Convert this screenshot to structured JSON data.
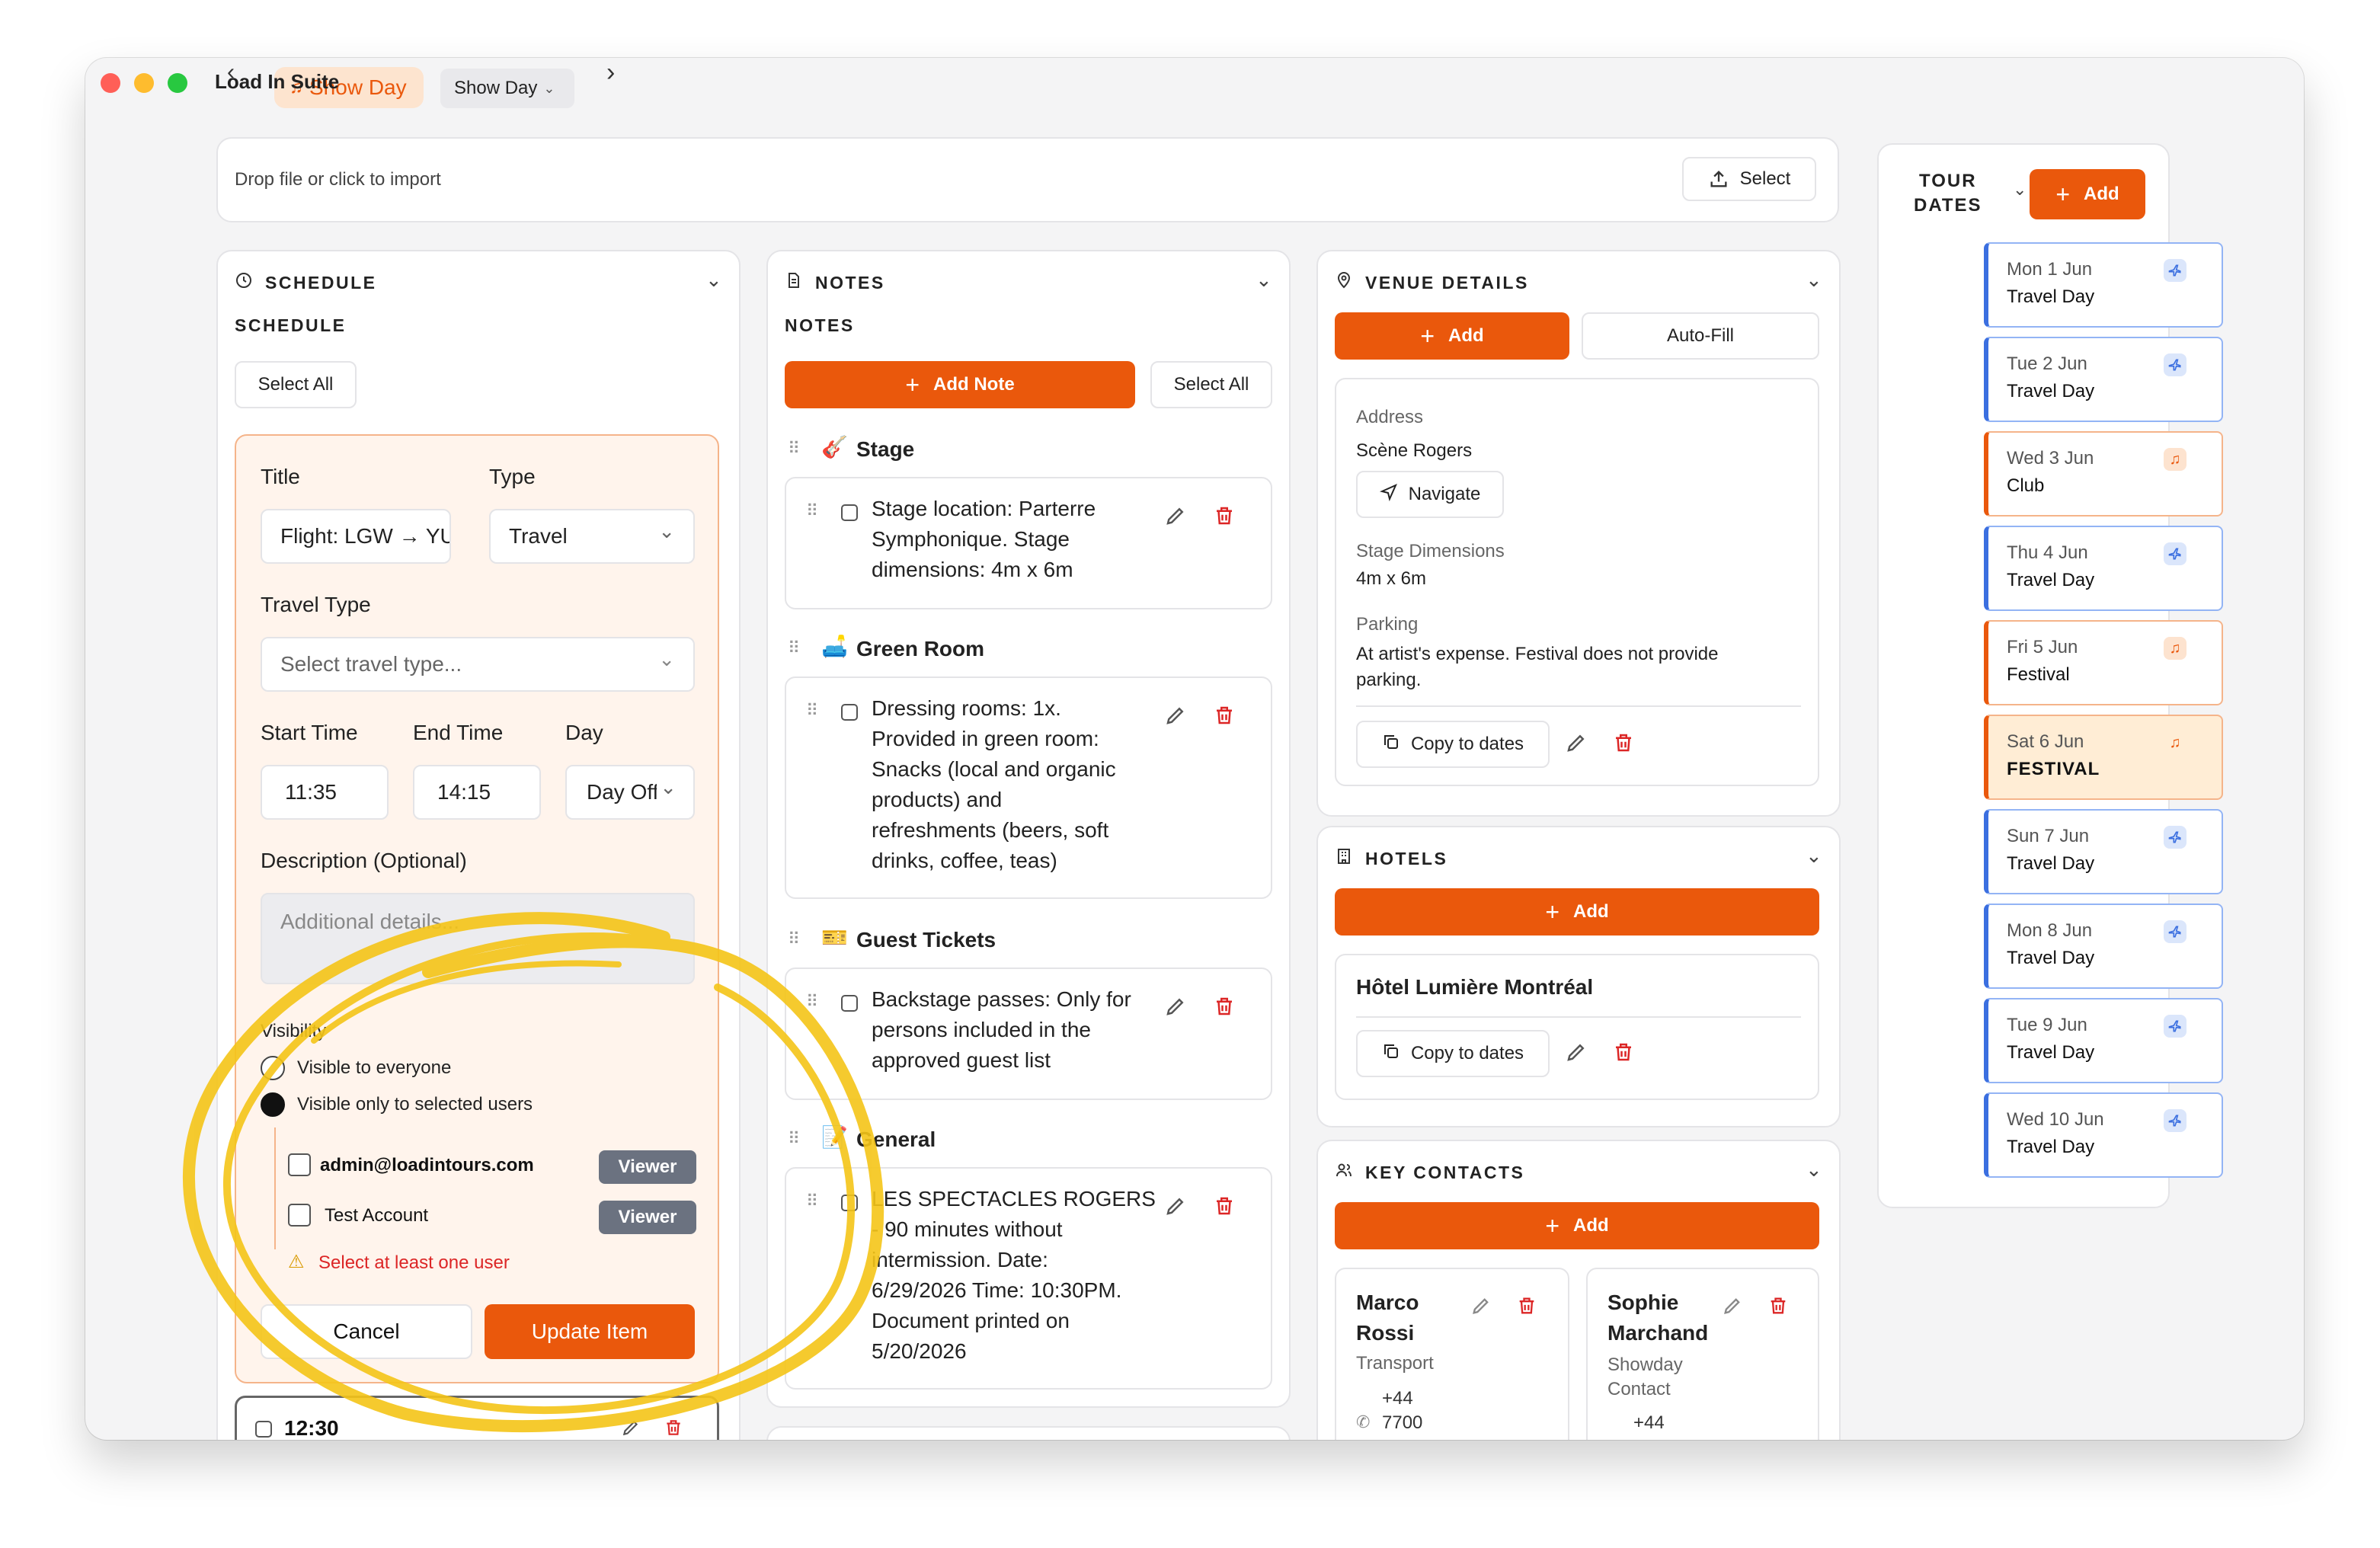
{
  "titlebar": {
    "app_title": "Load In Suite",
    "day_badge": "Show Day",
    "day_select": "Show Day"
  },
  "import_bar": {
    "placeholder": "Drop file or click to import",
    "select_label": "Select"
  },
  "schedule": {
    "header": "SCHEDULE",
    "subheader": "SCHEDULE",
    "select_all": "Select All",
    "form": {
      "title_label": "Title",
      "title_value": "Flight: LGW → YUL",
      "type_label": "Type",
      "type_value": "Travel",
      "travel_type_label": "Travel Type",
      "travel_type_placeholder": "Select travel type...",
      "start_label": "Start Time",
      "start_value": "11:35",
      "end_label": "End Time",
      "end_value": "14:15",
      "day_label": "Day",
      "day_value": "Day Off",
      "desc_label": "Description (Optional)",
      "desc_placeholder": "Additional details...",
      "visibility_label": "Visibility",
      "visibility_options": [
        "Visible to everyone",
        "Visible only to selected users"
      ],
      "users": [
        {
          "email": "admin@loadintours.com",
          "role": "Viewer"
        },
        {
          "email": "Test Account",
          "role": "Viewer"
        }
      ],
      "warning": "Select at least one user",
      "cancel": "Cancel",
      "update": "Update Item"
    },
    "next_item_time": "12:30"
  },
  "notes": {
    "header": "NOTES",
    "subheader": "NOTES",
    "add_note": "Add Note",
    "select_all": "Select All",
    "sections": [
      {
        "emoji": "🎸",
        "title": "Stage",
        "text": [
          "Stage location: Parterre",
          "Symphonique. Stage",
          "dimensions: 4m x 6m"
        ]
      },
      {
        "emoji": "🛋️",
        "title": "Green Room",
        "text": [
          "Dressing rooms: 1x.",
          "Provided in green room:",
          "Snacks (local and organic",
          "products) and",
          "refreshments (beers, soft",
          "drinks, coffee, teas)"
        ]
      },
      {
        "emoji": "🎫",
        "title": "Guest Tickets",
        "text": [
          "Backstage passes: Only for",
          "persons included in the",
          "approved guest list"
        ]
      },
      {
        "emoji": "📝",
        "title": "General",
        "text": [
          "LES SPECTACLES ROGERS",
          "- 90 minutes without",
          "intermission. Date:",
          "6/29/2026 Time: 10:30PM.",
          "Document printed on",
          "5/20/2026"
        ]
      }
    ]
  },
  "venue": {
    "header": "VENUE DETAILS",
    "add": "Add",
    "autofill": "Auto-Fill",
    "address_label": "Address",
    "address_value": "Scène Rogers",
    "navigate": "Navigate",
    "stage_label": "Stage Dimensions",
    "stage_value": "4m x 6m",
    "parking_label": "Parking",
    "parking_value_1": "At artist's expense. Festival does not provide",
    "parking_value_2": "parking.",
    "copy": "Copy to dates"
  },
  "hotels": {
    "header": "HOTELS",
    "add": "Add",
    "name": "Hôtel Lumière Montréal",
    "copy": "Copy to dates"
  },
  "contacts": {
    "header": "KEY CONTACTS",
    "add": "Add",
    "people": [
      {
        "first": "Marco",
        "last": "Rossi",
        "role_1": "Transport",
        "role_2": "",
        "phone_1": "+44",
        "phone_2": "7700"
      },
      {
        "first": "Sophie",
        "last": "Marchand",
        "role_1": "Showday",
        "role_2": "Contact",
        "phone_1": "+44",
        "phone_2": ""
      }
    ]
  },
  "tour_dates": {
    "header_1": "TOUR",
    "header_2": "DATES",
    "add": "Add",
    "dates": [
      {
        "date": "Mon 1 Jun",
        "type": "Travel Day",
        "icon": "plane-icon"
      },
      {
        "date": "Tue 2 Jun",
        "type": "Travel Day",
        "icon": "plane-icon"
      },
      {
        "date": "Wed 3 Jun",
        "type": "Club",
        "icon": "music-icon"
      },
      {
        "date": "Thu 4 Jun",
        "type": "Travel Day",
        "icon": "plane-icon"
      },
      {
        "date": "Fri 5 Jun",
        "type": "Festival",
        "icon": "music-icon"
      },
      {
        "date": "Sat 6 Jun",
        "type": "FESTIVAL",
        "icon": "music-icon"
      },
      {
        "date": "Sun 7 Jun",
        "type": "Travel Day",
        "icon": "plane-icon"
      },
      {
        "date": "Mon 8 Jun",
        "type": "Travel Day",
        "icon": "plane-icon"
      },
      {
        "date": "Tue 9 Jun",
        "type": "Travel Day",
        "icon": "plane-icon"
      },
      {
        "date": "Wed 10 Jun",
        "type": "Travel Day",
        "icon": "plane-icon"
      }
    ]
  },
  "colors": {
    "accent": "#ea580c",
    "travel": "#3b6fe0",
    "danger": "#dc2626",
    "highlight": "#f5c518"
  }
}
